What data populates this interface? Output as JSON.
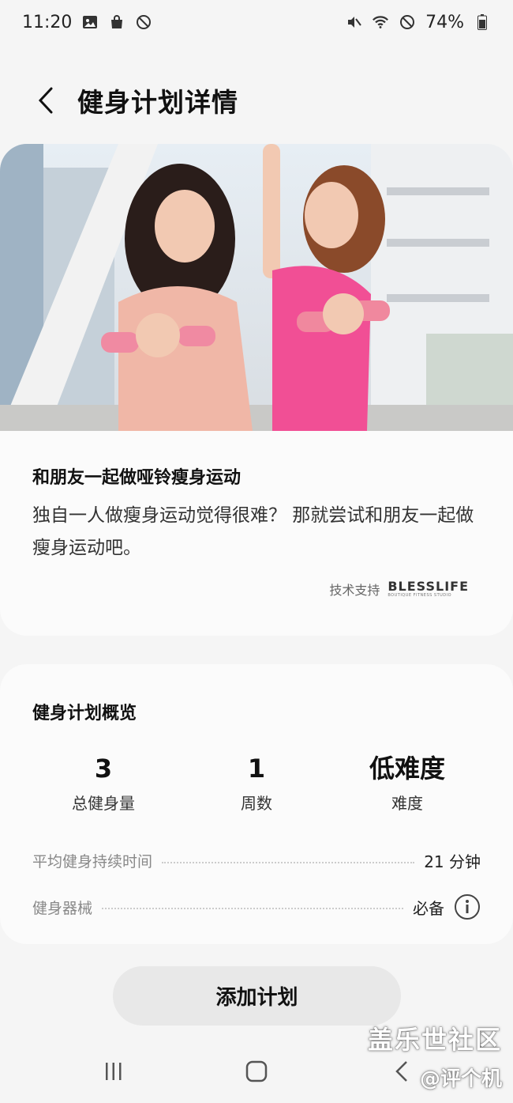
{
  "status": {
    "time": "11:20",
    "battery": "74%"
  },
  "header": {
    "title": "健身计划详情"
  },
  "plan": {
    "heading": "和朋友一起做哑铃瘦身运动",
    "description": "独自一人做瘦身运动觉得很难？ 那就尝试和朋友一起做瘦身运动吧。",
    "credit_label": "技术支持",
    "brand": "BLESSLIFE",
    "brand_sub": "BOUTIQUE FITNESS STUDIO"
  },
  "overview": {
    "title": "健身计划概览",
    "stats": [
      {
        "value": "3",
        "label": "总健身量"
      },
      {
        "value": "1",
        "label": "周数"
      },
      {
        "value": "低难度",
        "label": "难度"
      }
    ],
    "rows": [
      {
        "label": "平均健身持续时间",
        "value": "21 分钟"
      },
      {
        "label": "健身器械",
        "value": "必备"
      }
    ]
  },
  "add_button": "添加计划",
  "watermark": {
    "line1": "盖乐世社区",
    "line2": "@评个机"
  },
  "icons": {
    "status_left": [
      "gallery-icon",
      "shopping-bag-icon",
      "blocked-sync-icon"
    ],
    "status_right": [
      "vibrate-mute-icon",
      "wifi-icon",
      "do-not-disturb-icon",
      "battery-icon"
    ],
    "nav": [
      "recent-apps-icon",
      "home-icon",
      "back-icon"
    ]
  }
}
